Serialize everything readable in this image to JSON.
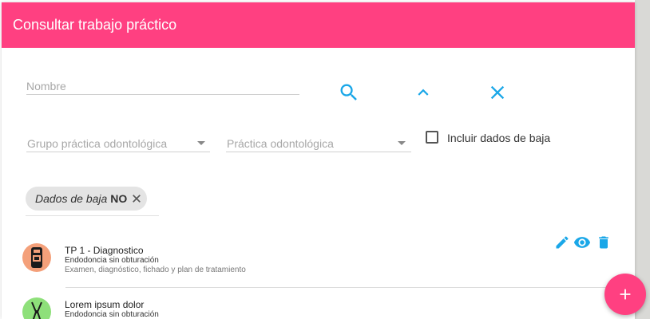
{
  "header": {
    "title": "Consultar trabajo práctico"
  },
  "filters": {
    "name_placeholder": "Nombre",
    "group_placeholder": "Grupo práctica odontológica",
    "practice_placeholder": "Práctica odontológica",
    "include_deleted_label": "Incluir dados de baja",
    "include_deleted_checked": false
  },
  "chip": {
    "label": "Dados de baja",
    "value": "NO"
  },
  "items": [
    {
      "title": "TP 1 - Diagnostico",
      "subtitle": "Endodoncia sin obturación",
      "description": "Examen, diagnóstico, fichado y plan de tratamiento",
      "avatar_color": "#f4a07a",
      "avatar_icon": "dental-cabinet-icon"
    },
    {
      "title": "Lorem ipsum dolor",
      "subtitle": "Endodoncia sin obturación",
      "avatar_color": "#8ee07a",
      "avatar_icon": "dental-tool-icon"
    }
  ],
  "colors": {
    "accent": "#ff4081",
    "action_blue": "#1aa7e8"
  },
  "icons": {
    "search": "search-icon",
    "collapse": "chevron-up-icon",
    "clear": "close-icon",
    "edit": "edit-icon",
    "view": "eye-icon",
    "delete": "delete-icon",
    "add": "plus-icon"
  }
}
